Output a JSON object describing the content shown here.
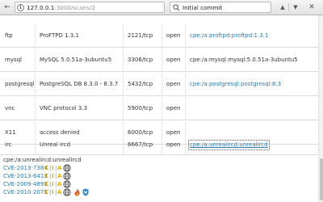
{
  "browser": {
    "url_host": "127.0.0.1",
    "url_path": ":3000/scans/2",
    "search_text": "Initial commit"
  },
  "services": [
    {
      "service": "ftp",
      "product": "ProFTPD 1.3.1",
      "port": "2121/tcp",
      "state": "open",
      "cpe": "cpe:/a:proftpd:proftpd:1.3.1",
      "cpe_style": "link"
    },
    {
      "service": "mysql",
      "product": "MySQL 5.0.51a-3ubuntu5",
      "port": "3306/tcp",
      "state": "open",
      "cpe": "cpe:/a:mysql:mysql:5.0.51a-3ubuntu5",
      "cpe_style": "plain"
    },
    {
      "service": "postgresql",
      "product": "PostgreSQL DB 8.3.0 - 8.3.7",
      "port": "5432/tcp",
      "state": "open",
      "cpe": "cpe:/a:postgresql:postgresql:8.3",
      "cpe_style": "link"
    },
    {
      "service": "vnc",
      "product": "VNC protocol 3.3",
      "port": "5900/tcp",
      "state": "open",
      "cpe": "",
      "cpe_style": "none"
    },
    {
      "service": "X11",
      "product": "access denied",
      "port": "6000/tcp",
      "state": "open",
      "cpe": "",
      "cpe_style": "none"
    },
    {
      "service": "irc",
      "product": "Unreal ircd",
      "port": "6667/tcp",
      "state": "open",
      "cpe": "cpe:/a:unrealircd:unrealircd",
      "cpe_style": "focused"
    }
  ],
  "cve_section": {
    "heading": "cpe:/a:unrealircd:unrealircd",
    "entries": [
      {
        "id": "CVE-2013-7384",
        "c": "C",
        "i": "I",
        "a": "A",
        "sep": "|",
        "icons": [
          "globe-icon"
        ]
      },
      {
        "id": "CVE-2013-6413",
        "c": "C",
        "i": "I",
        "a": "A",
        "sep": "|",
        "icons": [
          "globe-icon"
        ]
      },
      {
        "id": "CVE-2009-4893",
        "c": "C",
        "i": "I",
        "a": "A",
        "sep": "|",
        "icons": [
          "globe-icon"
        ]
      },
      {
        "id": "CVE-2010-2075",
        "c": "C",
        "i": "I",
        "a": "A",
        "sep": "|",
        "icons": [
          "globe-icon",
          "exploit-fire-icon",
          "shield-icon"
        ]
      }
    ]
  },
  "colors": {
    "link": "#2a7ab0",
    "cia_yellow": "#d9a400"
  }
}
